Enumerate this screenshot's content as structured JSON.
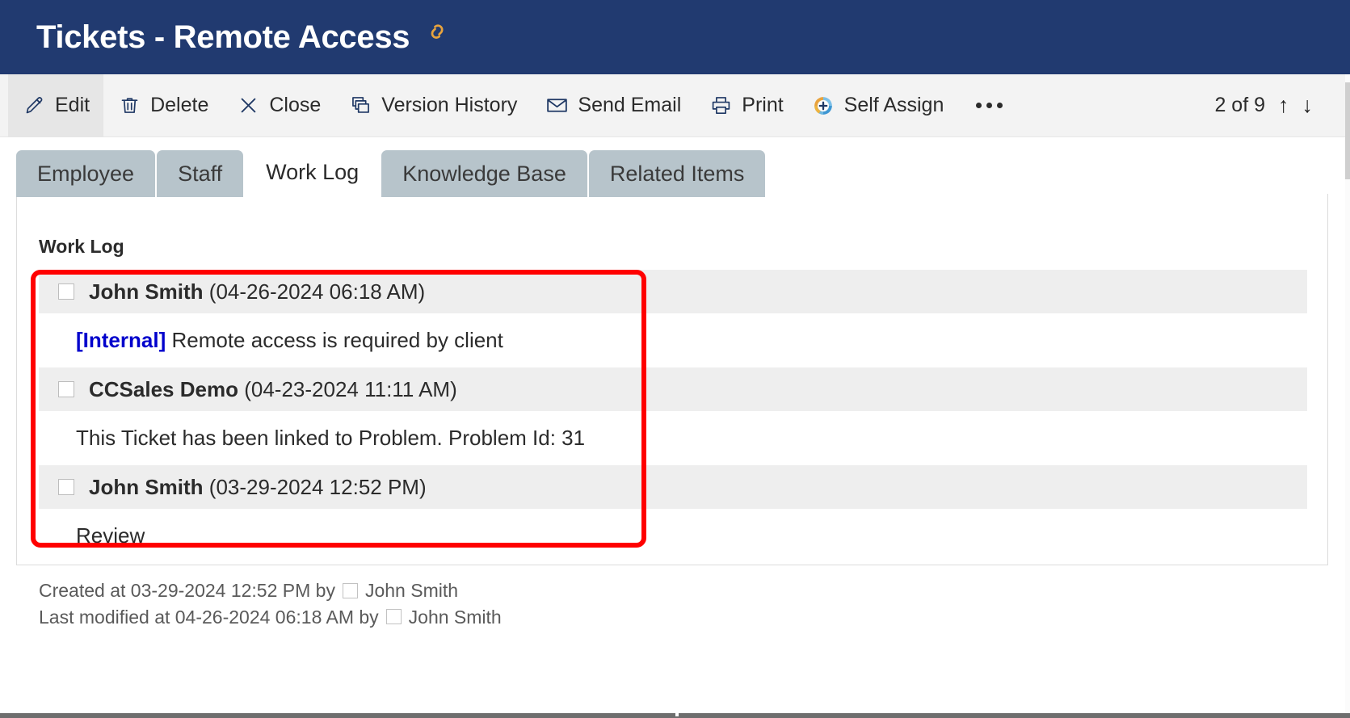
{
  "titlebar": {
    "title": "Tickets - Remote Access",
    "link_icon": "link-chain-icon",
    "bg_color": "#213a70",
    "icon_color": "#e8a33d"
  },
  "toolbar": {
    "buttons": [
      {
        "label": "Edit",
        "icon": "pencil-icon",
        "active": true
      },
      {
        "label": "Delete",
        "icon": "trash-icon",
        "active": false
      },
      {
        "label": "Close",
        "icon": "close-x-icon",
        "active": false
      },
      {
        "label": "Version History",
        "icon": "stacked-pages-icon",
        "active": false
      },
      {
        "label": "Send Email",
        "icon": "envelope-icon",
        "active": false
      },
      {
        "label": "Print",
        "icon": "printer-icon",
        "active": false
      },
      {
        "label": "Self Assign",
        "icon": "self-assign-icon",
        "active": false
      }
    ],
    "overflow_label": "...",
    "pager_text": "2 of 9",
    "pager_up": "↑",
    "pager_down": "↓"
  },
  "tabs": [
    {
      "label": "Employee",
      "active": false
    },
    {
      "label": "Staff",
      "active": false
    },
    {
      "label": "Work Log",
      "active": true
    },
    {
      "label": "Knowledge Base",
      "active": false
    },
    {
      "label": "Related Items",
      "active": false
    }
  ],
  "panel": {
    "section_title": "Work Log",
    "entries": [
      {
        "author": "John Smith",
        "timestamp": "(04-26-2024 06:18 AM)",
        "tag": "[Internal]",
        "message": "Remote access is required by client"
      },
      {
        "author": "CCSales Demo",
        "timestamp": "(04-23-2024 11:11 AM)",
        "tag": "",
        "message": "This Ticket has been linked to Problem. Problem Id: 31"
      },
      {
        "author": "John Smith",
        "timestamp": "(03-29-2024 12:52 PM)",
        "tag": "",
        "message": "Review"
      }
    ]
  },
  "footer": {
    "created": "Created at 03-29-2024 12:52 PM by",
    "created_by": "John Smith",
    "modified": "Last modified at 04-26-2024 06:18 AM by",
    "modified_by": "John Smith"
  },
  "annotation": {
    "color": "#ff0000",
    "shape": "rounded-rectangle-highlight"
  }
}
